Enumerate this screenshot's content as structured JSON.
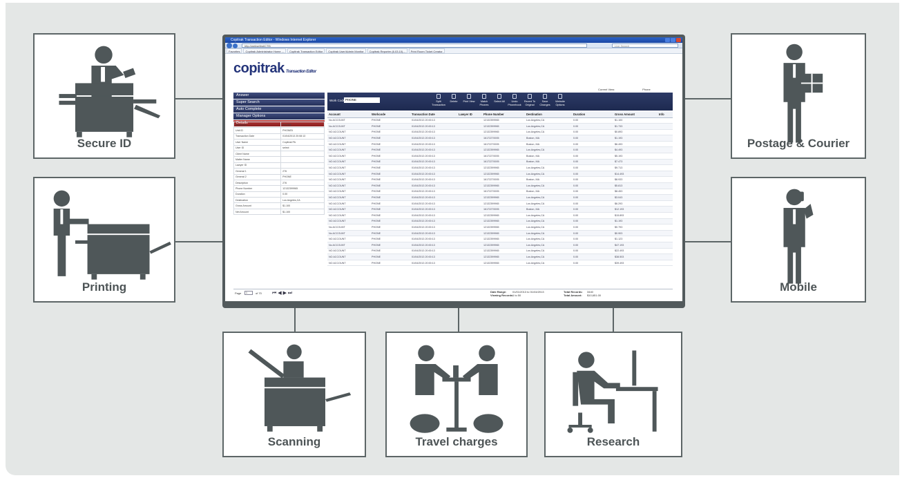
{
  "cards": {
    "secure_id": "Secure ID",
    "printing": "Printing",
    "scanning": "Scanning",
    "travel": "Travel charges",
    "research": "Research",
    "postage": "Postage & Courier",
    "mobile": "Mobile"
  },
  "window": {
    "title": "Copitrak Transaction Editor - Windows Internet Explorer",
    "url": "http://websefirst/CTE/",
    "search_placeholder": "Live Search",
    "tabs": [
      "Favorites",
      "Copitrak Administrator Home ...",
      "Copitrak Transaction Editor",
      "Copitrak User/Admin Monitor",
      "Copitrak Reporter (6.03.10)...",
      "Print Room Ticket Creator"
    ]
  },
  "app": {
    "logo": "copitrak",
    "logo_sub": "Transaction Editor",
    "current_view_label": "Current View:",
    "current_view_value": "Phone",
    "nav": [
      "Answer",
      "Super Search",
      "Auto Complete",
      "Manager Options",
      "Details"
    ],
    "work_code_label": "Work Codes:",
    "work_code_value": "PHONE",
    "toolbar": [
      "Split Transaction",
      "Delete",
      "Print View",
      "Match Phones",
      "Select All",
      "Undo Phonebook",
      "Revert To Original",
      "Save Changes",
      "Website Options"
    ],
    "details": [
      [
        "Workcode",
        "PHONE"
      ],
      [
        "Unit ID",
        "PHONE5"
      ],
      [
        "Transaction Date",
        "01/04/2013 20:08:13"
      ],
      [
        "User Name",
        "Copitrak PA"
      ],
      [
        "User ID",
        "select"
      ],
      [
        "Client Name",
        ""
      ],
      [
        "Matter Name",
        ""
      ],
      [
        "Lawyer ID",
        ""
      ],
      [
        "General 1",
        "276"
      ],
      [
        "General 2",
        "PHONE"
      ],
      [
        "Description",
        "276"
      ],
      [
        "Phone Number",
        "12132399965"
      ],
      [
        "Duration",
        "0.00"
      ],
      [
        "Destination",
        "Los Angeles,CA"
      ],
      [
        "Gross Amount",
        "$1.100"
      ],
      [
        "Net Amount",
        "$1.100"
      ]
    ],
    "columns": [
      "Account",
      "Workcode",
      "Transaction Date",
      "Lawyer ID",
      "Phone Number",
      "Destination",
      "Duration",
      "Gross Amount",
      "Info"
    ],
    "rows": [
      [
        "No ACCOUNT",
        "PHONE",
        "01/04/2013 20:00:13",
        "",
        "12132399965",
        "Los Angeles,CA",
        "0.00",
        "$1.100"
      ],
      [
        "No ACCOUNT",
        "PHONE",
        "01/04/2013 20:00:13",
        "",
        "12132399965",
        "Los Angeles,CA",
        "0.00",
        "$1.733"
      ],
      [
        "NO ACCOUNT",
        "PHONE",
        "01/04/2013 20:00:13",
        "",
        "12132399965",
        "Los Angeles,CA",
        "0.00",
        "$0.893"
      ],
      [
        "NO ACCOUNT",
        "PHONE",
        "01/04/2013 20:00:13",
        "",
        "16172270005",
        "Boston, MA",
        "0.00",
        "$1.193"
      ],
      [
        "NO ACCOUNT",
        "PHONE",
        "01/04/2013 20:00:13",
        "",
        "16172270005",
        "Boston, MA",
        "0.00",
        "$6.493"
      ],
      [
        "NO ACCOUNT",
        "PHONE",
        "01/04/2013 20:00:13",
        "",
        "12132399965",
        "Los Angeles,CA",
        "0.00",
        "$4.493"
      ],
      [
        "NO ACCOUNT",
        "PHONE",
        "01/04/2013 20:00:13",
        "",
        "16172270005",
        "Boston, MA",
        "0.00",
        "$5.193"
      ],
      [
        "NO ACCOUNT",
        "PHONE",
        "01/04/2013 20:00:13",
        "",
        "16172270005",
        "Boston, MA",
        "0.00",
        "$7.473"
      ],
      [
        "NO ACCOUNT",
        "PHONE",
        "01/04/2013 20:00:13",
        "",
        "12132399965",
        "Los Angeles,CA",
        "0.00",
        "$9.713"
      ],
      [
        "NO ACCOUNT",
        "PHONE",
        "01/04/2013 20:00:13",
        "",
        "12132399965",
        "Los Angeles,CA",
        "0.00",
        "$14.493"
      ],
      [
        "NO ACCOUNT",
        "PHONE",
        "01/04/2013 20:00:13",
        "",
        "16172270005",
        "Boston, MA",
        "0.00",
        "$8.933"
      ],
      [
        "NO ACCOUNT",
        "PHONE",
        "01/04/2013 20:00:13",
        "",
        "12132399965",
        "Los Angeles,CA",
        "0.00",
        "$5.813"
      ],
      [
        "NO ACCOUNT",
        "PHONE",
        "01/04/2013 20:00:13",
        "",
        "16172270005",
        "Boston, MA",
        "0.00",
        "$8.453"
      ],
      [
        "NO ACCOUNT",
        "PHONE",
        "01/04/2013 20:00:13",
        "",
        "12132399965",
        "Los Angeles,CA",
        "0.00",
        "$3.043"
      ],
      [
        "NO ACCOUNT",
        "PHONE",
        "01/04/2013 20:00:13",
        "",
        "12132399965",
        "Los Angeles,CA",
        "0.00",
        "$6.293"
      ],
      [
        "NO ACCOUNT",
        "PHONE",
        "01/04/2013 20:00:13",
        "",
        "16172270005",
        "Boston, MA",
        "0.00",
        "$12.193"
      ],
      [
        "NO ACCOUNT",
        "PHONE",
        "01/04/2013 20:00:13",
        "",
        "12132399965",
        "Los Angeles,CA",
        "0.00",
        "$15.893"
      ],
      [
        "NO ACCOUNT",
        "PHONE",
        "01/04/2013 20:00:13",
        "",
        "12132399965",
        "Los Angeles,CA",
        "0.00",
        "$1.193"
      ],
      [
        "No ACCOUNT",
        "PHONE",
        "01/04/2013 20:00:13",
        "",
        "12132399965",
        "Los Angeles,CA",
        "0.00",
        "$0.793"
      ],
      [
        "No ACCOUNT",
        "PHONE",
        "01/04/2013 20:00:13",
        "",
        "12132399965",
        "Los Angeles,CA",
        "0.00",
        "$0.903"
      ],
      [
        "NO ACCOUNT",
        "PHONE",
        "01/04/2013 20:00:13",
        "",
        "12132399965",
        "Los Angeles,CA",
        "0.00",
        "$1.123"
      ],
      [
        "No ACCOUNT",
        "PHONE",
        "01/04/2013 20:00:13",
        "",
        "12132399965",
        "Los Angeles,CA",
        "0.00",
        "$47.193"
      ],
      [
        "NO ACCOUNT",
        "PHONE",
        "01/04/2013 20:00:13",
        "",
        "12132399965",
        "Los Angeles,CA",
        "0.00",
        "$22.493"
      ],
      [
        "NO ACCOUNT",
        "PHONE",
        "01/04/2013 20:00:13",
        "",
        "12132399965",
        "Los Angeles,CA",
        "0.00",
        "$38.503"
      ],
      [
        "NO ACCOUNT",
        "PHONE",
        "01/04/2013 20:00:13",
        "",
        "12132399965",
        "Los Angeles,CA",
        "0.00",
        "$39.493"
      ]
    ],
    "footer": {
      "page_label": "Page",
      "page_value": "1",
      "page_of": "of 70",
      "date_range_label": "Date Range:",
      "date_range_value": "01/01/2013 to 01/04/2013",
      "viewing_label": "Viewing Records:",
      "viewing_value": "1 to 50",
      "total_records_label": "Total Records:",
      "total_records_value": "3440",
      "total_amount_label": "Total Amount:",
      "total_amount_value": "$10,651.00"
    }
  },
  "colors": {
    "figure": "#4f5759",
    "background": "#e4e7e6",
    "nav": "#2b3665",
    "nav_active": "#a12e2e"
  }
}
